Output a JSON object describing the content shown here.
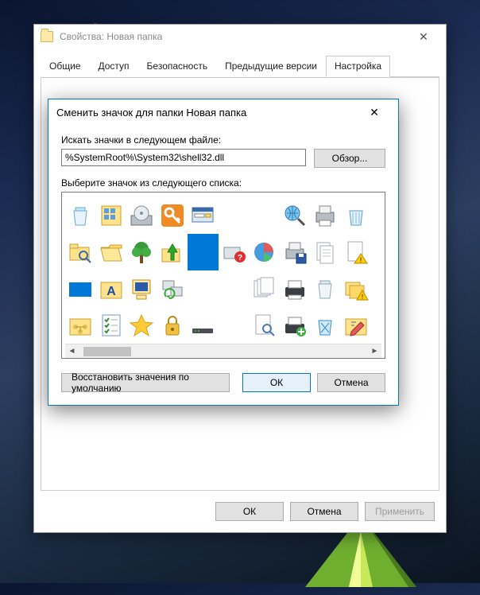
{
  "properties_window": {
    "title": "Свойства: Новая папка",
    "tabs": [
      "Общие",
      "Доступ",
      "Безопасность",
      "Предыдущие версии",
      "Настройка"
    ],
    "active_tab_index": 4,
    "buttons": {
      "ok": "ОК",
      "cancel": "Отмена",
      "apply": "Применить"
    }
  },
  "change_icon_dialog": {
    "title": "Сменить значок для папки Новая папка",
    "label_search": "Искать значки в следующем файле:",
    "path_value": "%SystemRoot%\\System32\\shell32.dll",
    "browse": "Обзор...",
    "label_choose": "Выберите значок из следующего списка:",
    "restore": "Восстановить значения по умолчанию",
    "ok": "ОК",
    "cancel": "Отмена",
    "selected_index": 14,
    "icons": [
      "recycle-bin-empty",
      "control-panel",
      "disc-drive",
      "key",
      "run-dialog",
      "blank",
      "blank",
      "magnifier-globe",
      "printer",
      "recycle-bin-glass",
      "folder-search",
      "folder-open-yellow",
      "tree",
      "folder-up-arrow",
      "blue-square",
      "help-device",
      "pie-chart",
      "printer-save",
      "documents",
      "doc-warning",
      "blue-rect",
      "font-folder",
      "computer-crt",
      "network-refresh",
      "blank",
      "blank",
      "docs-stack",
      "printer-flat",
      "recycle-bin",
      "folders-warning",
      "folder-network",
      "checklist",
      "star",
      "padlock",
      "device-bar",
      "blank",
      "doc-search",
      "printer-plus",
      "recycle-blue",
      "folder-pencil"
    ]
  }
}
